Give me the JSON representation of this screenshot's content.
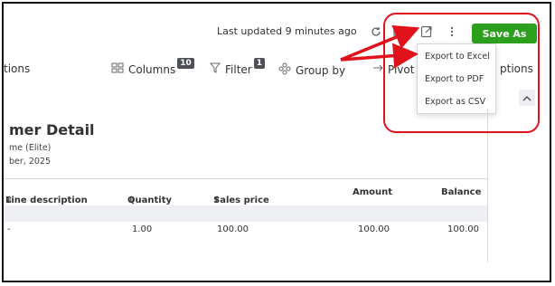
{
  "toolbar": {
    "last_updated": "Last updated 9 minutes ago",
    "save_as_label": "Save As",
    "icons": [
      "refresh-icon",
      "print-icon",
      "export-icon",
      "more-options-icon"
    ]
  },
  "options_bar": {
    "options_label": "tions",
    "columns_label": "Columns",
    "columns_count": "10",
    "filter_label": "Filter",
    "filter_count": "1",
    "group_by_label": "Group by",
    "pivot_label": "Pivot",
    "options_label_right": "ptions"
  },
  "export_menu": {
    "items": [
      "Export to Excel",
      "Export to PDF",
      "Export as CSV"
    ]
  },
  "report": {
    "title": "mer Detail",
    "subtitle_1": "me (Elite)",
    "subtitle_2": "ber, 2025",
    "columns": [
      "Line description",
      "Quantity",
      "Sales price",
      "Amount",
      "Balance"
    ],
    "rows": [
      {
        "line_description": "-",
        "quantity": "1.00",
        "sales_price": "100.00",
        "amount": "100.00",
        "balance": "100.00"
      }
    ]
  },
  "colors": {
    "accent": "#2ca01c",
    "annotation": "#e0121b",
    "badge": "#4d5157"
  }
}
